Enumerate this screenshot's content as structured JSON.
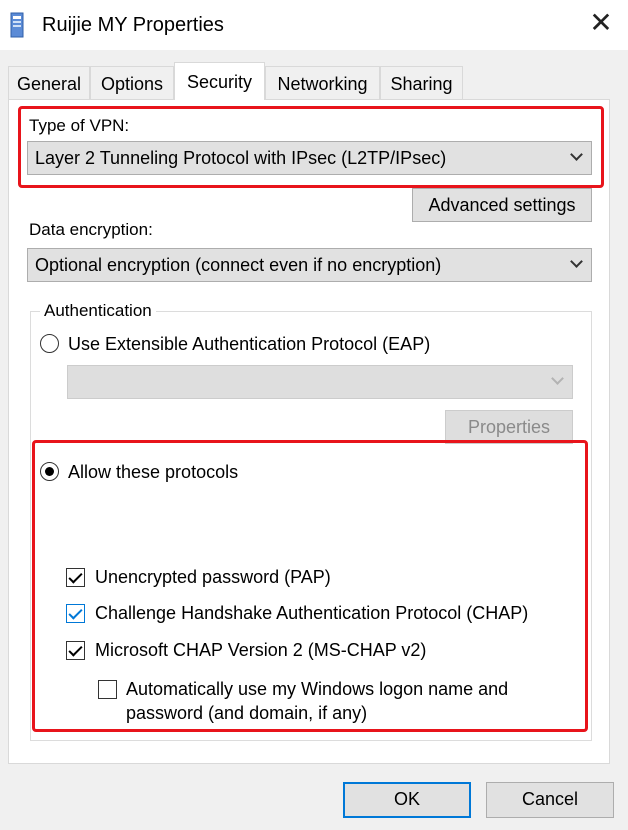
{
  "window": {
    "title": "Ruijie MY Properties",
    "close_glyph": "✕"
  },
  "tabs": [
    {
      "label": "General",
      "active": false
    },
    {
      "label": "Options",
      "active": false
    },
    {
      "label": "Security",
      "active": true
    },
    {
      "label": "Networking",
      "active": false
    },
    {
      "label": "Sharing",
      "active": false
    }
  ],
  "security": {
    "vpn_type_label": "Type of VPN:",
    "vpn_type_value": "Layer 2 Tunneling Protocol with IPsec (L2TP/IPsec)",
    "advanced_settings_label": "Advanced settings",
    "data_encryption_label": "Data encryption:",
    "data_encryption_value": "Optional encryption (connect even if no encryption)",
    "authentication": {
      "group_label": "Authentication",
      "eap_radio_label": "Use Extensible Authentication Protocol (EAP)",
      "eap_selected": false,
      "eap_dropdown_value": "",
      "properties_label": "Properties",
      "allow_radio_label": "Allow these protocols",
      "allow_selected": true,
      "protocols": [
        {
          "label": "Unencrypted password (PAP)",
          "checked": true
        },
        {
          "label": "Challenge Handshake Authentication Protocol (CHAP)",
          "checked": true
        },
        {
          "label": "Microsoft CHAP Version 2 (MS-CHAP v2)",
          "checked": true
        }
      ],
      "auto_logon_label_line1": "Automatically use my Windows logon name and",
      "auto_logon_label_line2": "password (and domain, if any)",
      "auto_logon_checked": false
    }
  },
  "footer": {
    "ok_label": "OK",
    "cancel_label": "Cancel"
  },
  "colors": {
    "highlight": "#e8141b",
    "focus_accent": "#0078d7"
  }
}
